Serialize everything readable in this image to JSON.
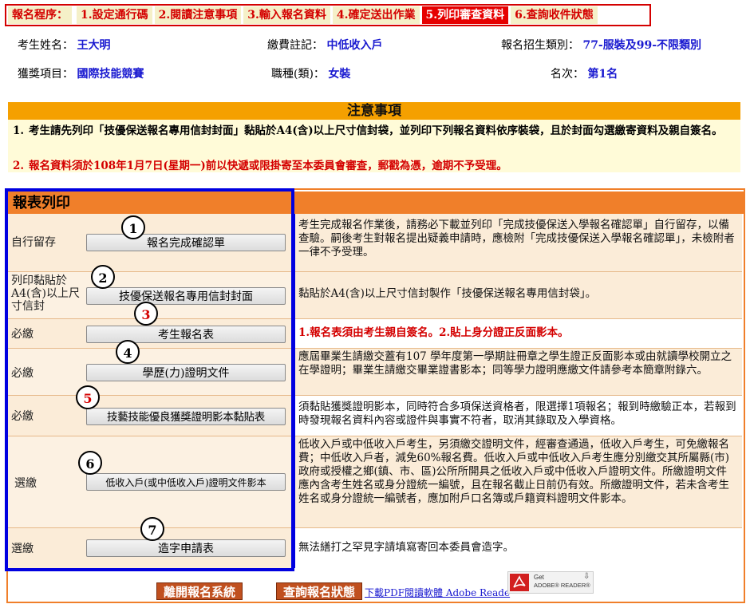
{
  "steps": {
    "head": "報名程序：",
    "s1": "1.設定通行碼",
    "s2": "2.閱讀注意事項",
    "s3": "3.輸入報名資料",
    "s4": "4.確定送出作業",
    "s5": "5.列印審查資料",
    "s6": "6.查詢收件狀態"
  },
  "info": {
    "name_label": "考生姓名：",
    "name_value": "王大明",
    "fee_label": "繳費註記：",
    "fee_value": "中低收入戶",
    "cat_label": "報名招生類別：",
    "cat_value": "77-服裝及99-不限類別",
    "award_label": "獲獎項目：",
    "award_value": "國際技能競賽",
    "trade_label": "職種(類)：",
    "trade_value": "女裝",
    "rank_label": "名次：",
    "rank_value": "第1名"
  },
  "notice": {
    "title": "注意事項",
    "item1_num": "1.",
    "item1_text": "考生請先列印「技優保送報名專用信封封面」黏貼於A4(含)以上尺寸信封袋，並列印下列報名資料依序裝袋，且於封面勾選繳寄資料及親自簽名。",
    "item2_num": "2.",
    "item2_text": "報名資料須於108年1月7日(星期一)前以快遞或限掛寄至本委員會審查，郵戳為憑，逾期不予受理。"
  },
  "report": {
    "title": "報表列印",
    "rows": [
      {
        "num": "1",
        "label": "自行留存",
        "button": "報名完成確認單",
        "desc": "考生完成報名作業後，請務必下載並列印「完成技優保送入學報名確認單」自行留存，以備查驗。嗣後考生對報名提出疑義申請時，應檢附「完成技優保送入學報名確認單」，未檢附者一律不予受理。"
      },
      {
        "num": "2",
        "label": "列印黏貼於A4(含)以上尺寸信封",
        "button": "技優保送報名專用信封封面",
        "desc": "黏貼於A4(含)以上尺寸信封製作「技優保送報名專用信封袋」。"
      },
      {
        "num": "3",
        "label": "必繳",
        "button": "考生報名表",
        "desc": "1.報名表須由考生親自簽名。2.貼上身分證正反面影本。"
      },
      {
        "num": "4",
        "label": "必繳",
        "button": "學歷(力)證明文件",
        "desc": "應屆畢業生請繳交蓋有107 學年度第一學期註冊章之學生證正反面影本或由就讀學校開立之在學證明；畢業生請繳交畢業證書影本；同等學力證明應繳文件請參考本簡章附錄六。"
      },
      {
        "num": "5",
        "label": "必繳",
        "button": "技藝技能優良獲獎證明影本黏貼表",
        "desc": "須黏貼獲獎證明影本，同時符合多項保送資格者，限選擇1項報名；報到時繳驗正本，若報到時發現報名資料內容或證件與事實不符者，取消其錄取及入學資格。"
      },
      {
        "num": "6",
        "label": "選繳",
        "button": "低收入戶(或中低收入戶)證明文件影本",
        "desc": "低收入戶或中低收入戶考生，另須繳交證明文件，經審查通過，低收入戶考生，可免繳報名費；中低收入戶者，減免60%報名費。低收入戶或中低收入戶考生應分別繳交其所屬縣(市)政府或授權之鄉(鎮、市、區)公所所開具之低收入戶或中低收入戶證明文件。所繳證明文件應內含考生姓名或身分證統一編號，且在報名截止日前仍有效。所繳證明文件，若未含考生姓名或身分證統一編號者，應加附戶口名簿或戶籍資料證明文件影本。"
      },
      {
        "num": "7",
        "label": "選繳",
        "button": "造字申請表",
        "desc": "無法繕打之罕見字請填寫寄回本委員會造字。"
      }
    ]
  },
  "footer": {
    "leave_button": "離開報名系統",
    "query_button": "查詢報名狀態",
    "pdf_link": "下載PDF閱讀軟體  Adobe Reade",
    "adobe_get": "Get",
    "adobe_name": "ADOBE® READER®"
  },
  "colors": {
    "step_active": "#e60000",
    "orange": "#f07f2a",
    "blue_highlight": "#0000e0",
    "value_blue": "#1a1ad0"
  }
}
